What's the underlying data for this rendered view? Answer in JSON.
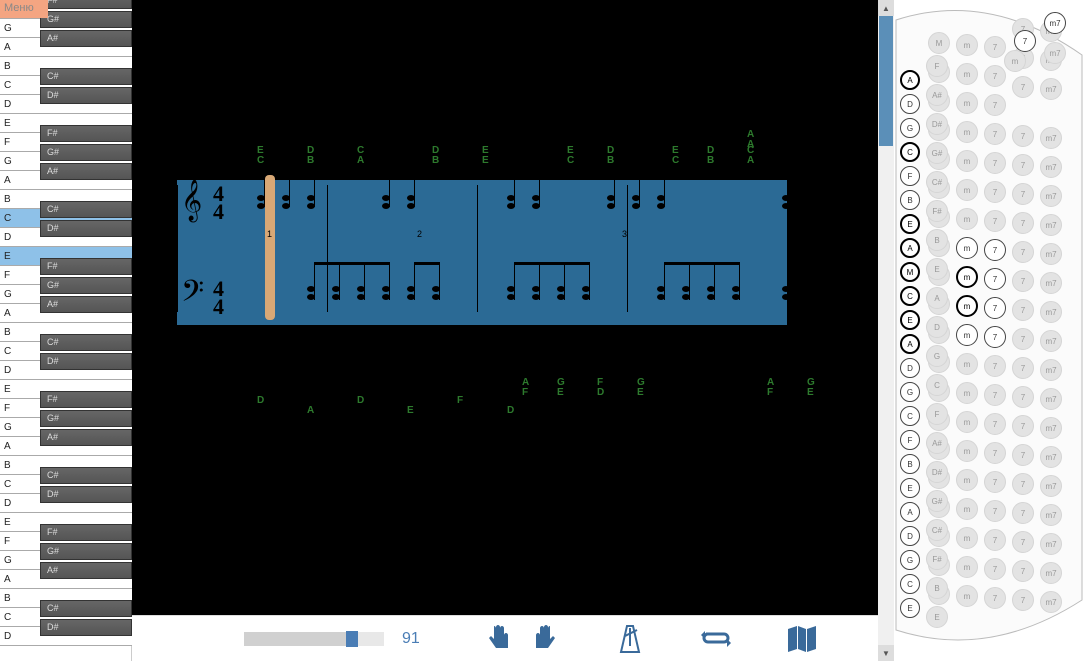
{
  "menu_label": "Меню",
  "piano": {
    "white_sequence": [
      "F",
      "G",
      "A",
      "B",
      "C",
      "D",
      "E",
      "F",
      "G",
      "A",
      "B",
      "C",
      "D",
      "E",
      "F",
      "G",
      "A",
      "B",
      "C",
      "D",
      "E",
      "F",
      "G",
      "A",
      "B",
      "C",
      "D",
      "E",
      "F",
      "G",
      "A",
      "B",
      "C",
      "D"
    ],
    "black_map": {
      "F": "F#",
      "G": "G#",
      "A": "A#",
      "C": "C#",
      "D": "D#"
    },
    "highlighted_white_indices": [
      11,
      13
    ],
    "visible_rows": 34
  },
  "score": {
    "time_signature": {
      "top": "4",
      "bottom": "4"
    },
    "playhead_measure": 1,
    "treble_labels": [
      {
        "col": 0,
        "stack": [
          "E",
          "C"
        ]
      },
      {
        "col": 1,
        "stack": [
          "D",
          "B"
        ]
      },
      {
        "col": 2,
        "stack": [
          "C",
          "A"
        ]
      },
      {
        "col": 3.5,
        "stack": [
          "D",
          "B"
        ]
      },
      {
        "col": 4.5,
        "stack": [
          "E",
          "E"
        ]
      },
      {
        "col": 6.2,
        "stack": [
          "E",
          "C"
        ]
      },
      {
        "col": 7.0,
        "stack": [
          "D",
          "B"
        ]
      },
      {
        "col": 8.3,
        "stack": [
          "E",
          "C"
        ]
      },
      {
        "col": 9.0,
        "stack": [
          "D",
          "B"
        ]
      },
      {
        "col": 9.8,
        "stack": [
          "C",
          "A"
        ]
      },
      {
        "col": 9.8,
        "stack_high": [
          "A",
          "A"
        ]
      }
    ],
    "fingerings": [
      {
        "col": 0.2,
        "n": "1"
      },
      {
        "col": 3.2,
        "n": "2"
      },
      {
        "col": 7.3,
        "n": "3"
      }
    ],
    "bass_labels": [
      {
        "col": 0,
        "t": "D"
      },
      {
        "col": 1,
        "t": "A"
      },
      {
        "col": 2,
        "t": "D"
      },
      {
        "col": 3,
        "t": "E"
      },
      {
        "col": 4,
        "t": "F"
      },
      {
        "col": 5,
        "t": "D"
      },
      {
        "col": 5.3,
        "stack": [
          "A",
          "F"
        ]
      },
      {
        "col": 6,
        "stack": [
          "G",
          "E"
        ]
      },
      {
        "col": 6.8,
        "stack": [
          "F",
          "D"
        ]
      },
      {
        "col": 7.6,
        "stack": [
          "G",
          "E"
        ]
      },
      {
        "col": 10.2,
        "stack": [
          "A",
          "F"
        ]
      },
      {
        "col": 11,
        "stack": [
          "G",
          "E"
        ]
      }
    ]
  },
  "toolbar": {
    "tempo_value": "91",
    "tempo_percent": 73,
    "icons": {
      "left_hand": "left-hand-icon",
      "right_hand": "right-hand-icon",
      "metronome": "metronome-icon",
      "loop": "loop-icon",
      "map": "map-icon"
    }
  },
  "accordion": {
    "bass_column_labels": [
      "A",
      "D",
      "G",
      "C",
      "F",
      "B",
      "E",
      "A",
      "M",
      "C",
      "E",
      "A",
      "D",
      "G",
      "C",
      "F",
      "B",
      "E",
      "A",
      "D",
      "G",
      "C",
      "E"
    ],
    "chord_cols": [
      "F",
      "A#",
      "D#",
      "G#",
      "C#",
      "F#",
      "B",
      "E",
      "A",
      "D",
      "G",
      "C",
      "F",
      "A#",
      "D#",
      "G#",
      "C#",
      "F#",
      "B",
      "E"
    ],
    "chord_types": [
      "",
      "M",
      "m",
      "7",
      "7",
      "m7"
    ],
    "selected": [
      "E",
      "A",
      "M",
      "C"
    ]
  }
}
